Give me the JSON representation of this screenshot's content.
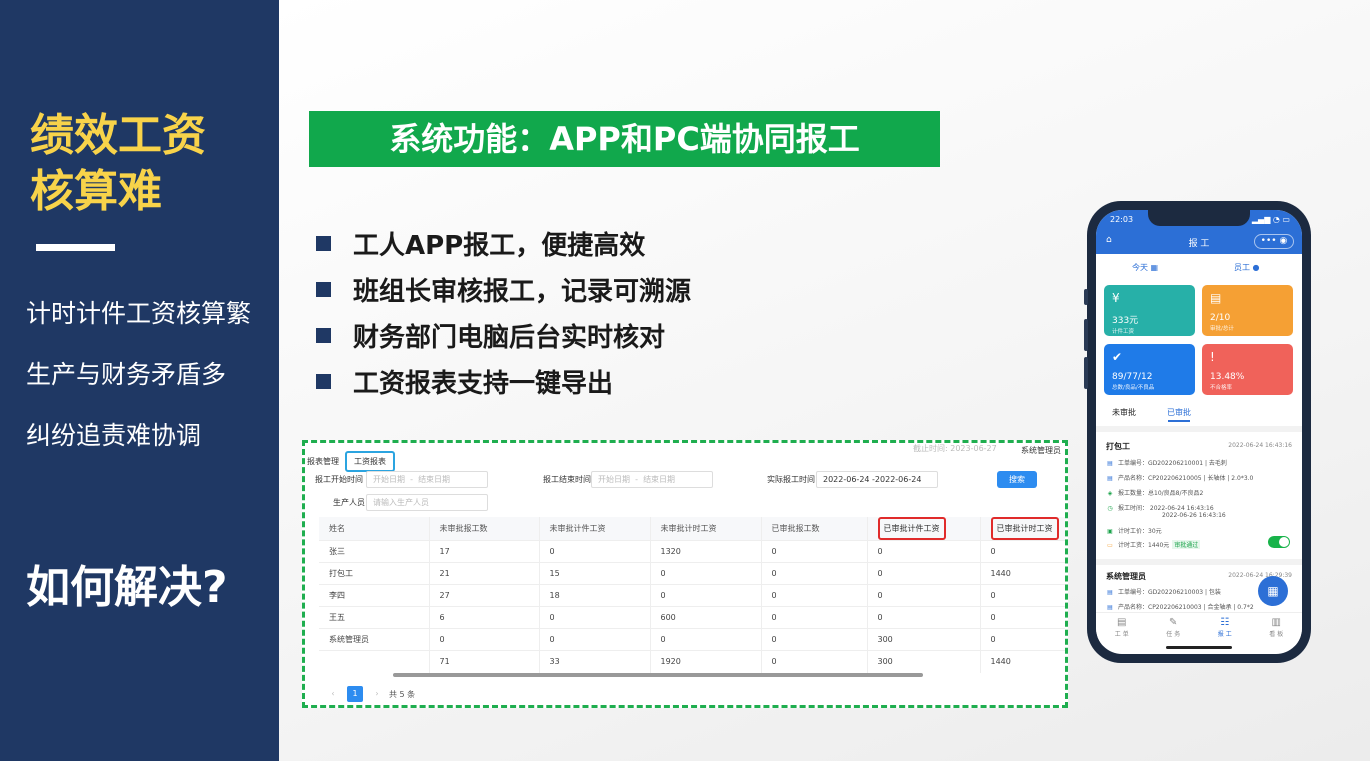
{
  "left": {
    "title_line1": "绩效工资",
    "title_line2": "核算难",
    "bullets": [
      "计时计件工资核算繁",
      "生产与财务矛盾多",
      "纠纷追责难协调"
    ],
    "question": "如何解决?"
  },
  "banner": "系统功能：APP和PC端协同报工",
  "features": [
    "工人APP报工，便捷高效",
    "班组长审核报工，记录可溯源",
    "财务部门电脑后台实时核对",
    "工资报表支持一键导出"
  ],
  "pc": {
    "crumb_parent": "报表管理",
    "crumb_current": "工资报表",
    "deadline": "截止时间: 2023-06-27",
    "admin": "系统管理员",
    "filters": {
      "start_label": "报工开始时间",
      "start_from": "开始日期",
      "start_to": "结束日期",
      "end_label": "报工结束时间",
      "end_from": "开始日期",
      "end_to": "结束日期",
      "actual_label": "实际报工时间",
      "actual_value": "2022-06-24 -2022-06-24",
      "person_label": "生产人员",
      "person_placeholder": "请输入生产人员",
      "search": "搜索"
    },
    "columns": [
      "姓名",
      "未审批报工数",
      "未审批计件工资",
      "未审批计时工资",
      "已审批报工数",
      "已审批计件工资",
      "已审批计时工资"
    ],
    "rows": [
      [
        "张三",
        "17",
        "0",
        "1320",
        "0",
        "0",
        "0"
      ],
      [
        "打包工",
        "21",
        "15",
        "0",
        "0",
        "0",
        "1440"
      ],
      [
        "李四",
        "27",
        "18",
        "0",
        "0",
        "0",
        "0"
      ],
      [
        "王五",
        "6",
        "0",
        "600",
        "0",
        "0",
        "0"
      ],
      [
        "系统管理员",
        "0",
        "0",
        "0",
        "0",
        "300",
        "0"
      ],
      [
        "",
        "71",
        "33",
        "1920",
        "0",
        "300",
        "1440"
      ]
    ],
    "pager": {
      "page": "1",
      "total": "共 5 条"
    }
  },
  "phone": {
    "time": "22:03",
    "title": "报 工",
    "nav_more": "•••",
    "today": "今天",
    "worker": "员工",
    "cards": [
      {
        "icon": "¥",
        "value": "333元",
        "label": "计件工资",
        "color": "#27b0a8"
      },
      {
        "icon": "▤",
        "value": "2/10",
        "label": "审批/总计",
        "color": "#f5a034"
      },
      {
        "icon": "✔",
        "value": "89/77/12",
        "label": "总数/良品/不良品",
        "color": "#1f7be8"
      },
      {
        "icon": "!",
        "value": "13.48%",
        "label": "不合格率",
        "color": "#f0625a"
      }
    ],
    "tab_pending": "未审批",
    "tab_approved": "已审批",
    "record1": {
      "name": "打包工",
      "date": "2022-06-24 16:43:16",
      "order": "工单编号：GD202206210001 | 去毛刺",
      "product": "产品名称：CP202206210005 | 长轴体 | 2.0*3.0",
      "qty": "报工数量：总10/良品8/不良品2",
      "time1": "报工时间：  2022-06-24 16:43:16",
      "time2": "2022-06-26 16:43:16",
      "price": "计时工价：30元",
      "wage": "计时工资：1440元",
      "status": "审批通过"
    },
    "record2": {
      "name": "系统管理员",
      "date": "2022-06-24 16:29:39",
      "order": "工单编号：GD202206210003 | 包装",
      "product": "产品名称：CP202206210003 | 合金轴承 | 0.7*2"
    },
    "tabbar": [
      "工 单",
      "任 务",
      "报 工",
      "看 板"
    ]
  }
}
